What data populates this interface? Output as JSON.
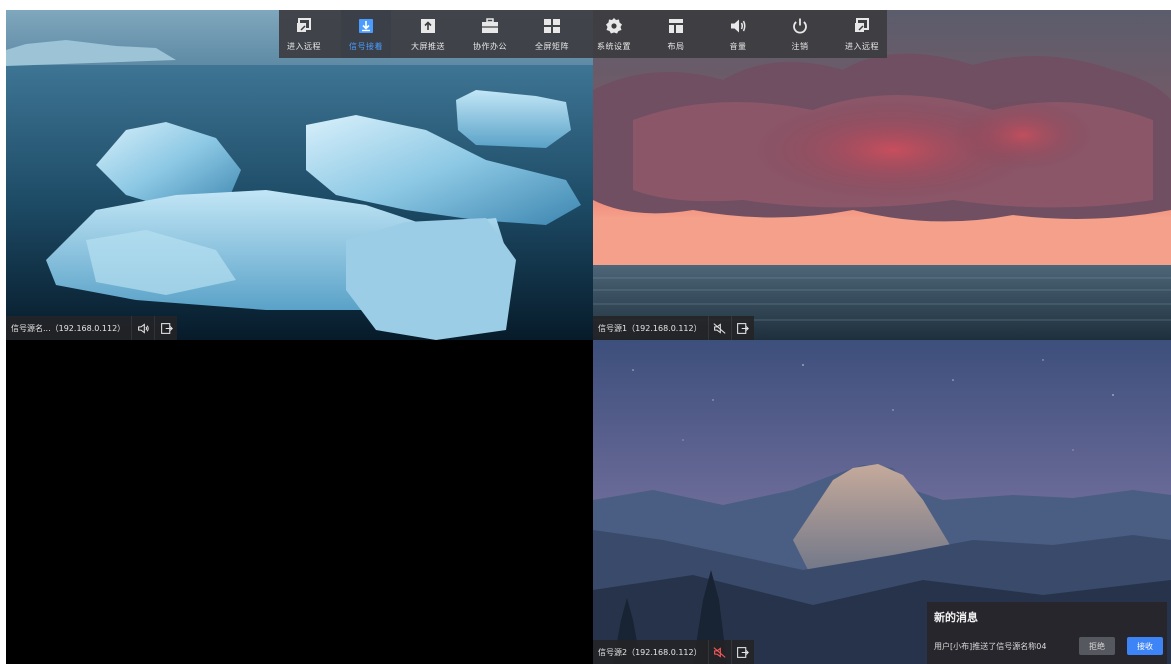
{
  "toolbar": {
    "items": [
      {
        "label": "进入远程",
        "icon": "remote-enter-icon",
        "active": false
      },
      {
        "label": "信号接着",
        "icon": "signal-receive-icon",
        "active": true
      },
      {
        "label": "大屏推送",
        "icon": "screen-push-icon",
        "active": false
      },
      {
        "label": "协作办公",
        "icon": "briefcase-icon",
        "active": false
      },
      {
        "label": "全屏矩阵",
        "icon": "grid-matrix-icon",
        "active": false
      },
      {
        "label": "系统设置",
        "icon": "gear-icon",
        "active": false
      },
      {
        "label": "布局",
        "icon": "layout-icon",
        "active": false
      },
      {
        "label": "音量",
        "icon": "volume-icon",
        "active": false
      },
      {
        "label": "注销",
        "icon": "power-icon",
        "active": false
      },
      {
        "label": "进入远程",
        "icon": "remote-enter-icon",
        "active": false
      }
    ],
    "active_color": "#4a9dff"
  },
  "panes": [
    {
      "source": "信号源名...（192.168.0.112）",
      "audio": "volume-on",
      "scene": "icebergs"
    },
    {
      "source": "信号源1（192.168.0.112）",
      "audio": "muted",
      "scene": "sunset-clouds-sea"
    },
    {
      "source": "",
      "audio": "",
      "scene": "empty-black"
    },
    {
      "source": "信号源2（192.168.0.112）",
      "audio": "muted-red",
      "scene": "night-mountains"
    }
  ],
  "notification": {
    "title": "新的消息",
    "message": "用户[小布]推送了信号源名称04",
    "reject_label": "拒绝",
    "accept_label": "接收",
    "accept_color": "#3d84f7"
  }
}
